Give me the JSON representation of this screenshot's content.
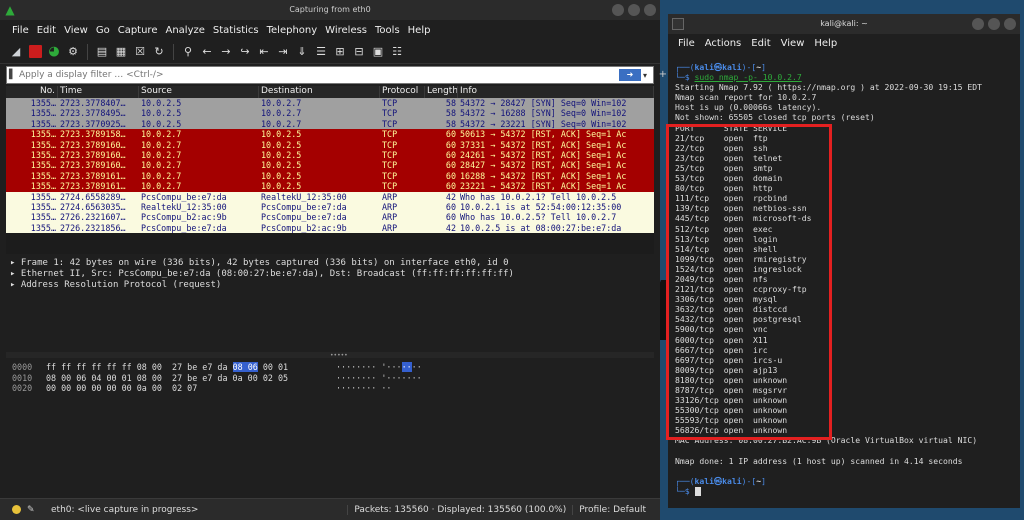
{
  "wireshark": {
    "title": "Capturing from eth0",
    "menu": [
      "File",
      "Edit",
      "View",
      "Go",
      "Capture",
      "Analyze",
      "Statistics",
      "Telephony",
      "Wireless",
      "Tools",
      "Help"
    ],
    "filter_placeholder": "Apply a display filter … <Ctrl-/>",
    "columns": [
      "No.",
      "Time",
      "Source",
      "Destination",
      "Protocol",
      "Length",
      "Info"
    ],
    "packets": [
      {
        "no": "1355…",
        "time": "2723.3778407…",
        "src": "10.0.2.5",
        "dst": "10.0.2.7",
        "proto": "TCP",
        "len": "58",
        "info": "54372 → 28427 [SYN] Seq=0 Win=102",
        "style": "gray"
      },
      {
        "no": "1355…",
        "time": "2723.3778495…",
        "src": "10.0.2.5",
        "dst": "10.0.2.7",
        "proto": "TCP",
        "len": "58",
        "info": "54372 → 16288 [SYN] Seq=0 Win=102",
        "style": "gray"
      },
      {
        "no": "1355…",
        "time": "2723.3770925…",
        "src": "10.0.2.5",
        "dst": "10.0.2.7",
        "proto": "TCP",
        "len": "58",
        "info": "54372 → 23221 [SYN] Seq=0 Win=102",
        "style": "gray"
      },
      {
        "no": "1355…",
        "time": "2723.3789158…",
        "src": "10.0.2.7",
        "dst": "10.0.2.5",
        "proto": "TCP",
        "len": "60",
        "info": "50613 → 54372 [RST, ACK] Seq=1 Ac",
        "style": "red"
      },
      {
        "no": "1355…",
        "time": "2723.3789160…",
        "src": "10.0.2.7",
        "dst": "10.0.2.5",
        "proto": "TCP",
        "len": "60",
        "info": "37331 → 54372 [RST, ACK] Seq=1 Ac",
        "style": "red"
      },
      {
        "no": "1355…",
        "time": "2723.3789160…",
        "src": "10.0.2.7",
        "dst": "10.0.2.5",
        "proto": "TCP",
        "len": "60",
        "info": "24261 → 54372 [RST, ACK] Seq=1 Ac",
        "style": "red"
      },
      {
        "no": "1355…",
        "time": "2723.3789160…",
        "src": "10.0.2.7",
        "dst": "10.0.2.5",
        "proto": "TCP",
        "len": "60",
        "info": "28427 → 54372 [RST, ACK] Seq=1 Ac",
        "style": "red"
      },
      {
        "no": "1355…",
        "time": "2723.3789161…",
        "src": "10.0.2.7",
        "dst": "10.0.2.5",
        "proto": "TCP",
        "len": "60",
        "info": "16288 → 54372 [RST, ACK] Seq=1 Ac",
        "style": "red"
      },
      {
        "no": "1355…",
        "time": "2723.3789161…",
        "src": "10.0.2.7",
        "dst": "10.0.2.5",
        "proto": "TCP",
        "len": "60",
        "info": "23221 → 54372 [RST, ACK] Seq=1 Ac",
        "style": "red"
      },
      {
        "no": "1355…",
        "time": "2724.6558289…",
        "src": "PcsCompu_be:e7:da",
        "dst": "RealtekU_12:35:00",
        "proto": "ARP",
        "len": "42",
        "info": "Who has 10.0.2.1? Tell 10.0.2.5",
        "style": "cream"
      },
      {
        "no": "1355…",
        "time": "2724.6563035…",
        "src": "RealtekU_12:35:00",
        "dst": "PcsCompu_be:e7:da",
        "proto": "ARP",
        "len": "60",
        "info": "10.0.2.1 is at 52:54:00:12:35:00",
        "style": "cream"
      },
      {
        "no": "1355…",
        "time": "2726.2321607…",
        "src": "PcsCompu_b2:ac:9b",
        "dst": "PcsCompu_be:e7:da",
        "proto": "ARP",
        "len": "60",
        "info": "Who has 10.0.2.5? Tell 10.0.2.7",
        "style": "cream"
      },
      {
        "no": "1355…",
        "time": "2726.2321856…",
        "src": "PcsCompu_be:e7:da",
        "dst": "PcsCompu_b2:ac:9b",
        "proto": "ARP",
        "len": "42",
        "info": "10.0.2.5 is at 08:00:27:be:e7:da",
        "style": "cream"
      }
    ],
    "details": [
      "Frame 1: 42 bytes on wire (336 bits), 42 bytes captured (336 bits) on interface eth0, id 0",
      "Ethernet II, Src: PcsCompu_be:e7:da (08:00:27:be:e7:da), Dst: Broadcast (ff:ff:ff:ff:ff:ff)",
      "Address Resolution Protocol (request)"
    ],
    "hex": [
      {
        "off": "0000",
        "pre": "ff ff ff ff ff ff 08 00  27 be e7 da ",
        "hl": "08 06",
        "post": " 00 01",
        "asc_pre": "········ '···",
        "asc_hl": "··",
        "asc_post": "··"
      },
      {
        "off": "0010",
        "pre": "08 00 06 04 00 01 08 00  27 be e7 da 0a 00 02 05",
        "hl": "",
        "post": "",
        "asc_pre": "········ '·······",
        "asc_hl": "",
        "asc_post": ""
      },
      {
        "off": "0020",
        "pre": "00 00 00 00 00 00 0a 00  02 07",
        "hl": "",
        "post": "",
        "asc_pre": "········ ··",
        "asc_hl": "",
        "asc_post": ""
      }
    ],
    "status": {
      "iface": "eth0: <live capture in progress>",
      "packets": "Packets: 135560 · Displayed: 135560 (100.0%)",
      "profile": "Profile: Default"
    }
  },
  "terminal": {
    "title": "kali@kali: ~",
    "menu": [
      "File",
      "Actions",
      "Edit",
      "View",
      "Help"
    ],
    "prompt_user": "kali㉿kali",
    "prompt_dir": "~",
    "command": "sudo nmap -p- 10.0.2.7",
    "output_head": [
      "Starting Nmap 7.92 ( https://nmap.org ) at 2022-09-30 19:15 EDT",
      "Nmap scan report for 10.0.2.7",
      "Host is up (0.00066s latency).",
      "Not shown: 65505 closed tcp ports (reset)"
    ],
    "ports_header": "PORT      STATE SERVICE",
    "ports": [
      "21/tcp    open  ftp",
      "22/tcp    open  ssh",
      "23/tcp    open  telnet",
      "25/tcp    open  smtp",
      "53/tcp    open  domain",
      "80/tcp    open  http",
      "111/tcp   open  rpcbind",
      "139/tcp   open  netbios-ssn",
      "445/tcp   open  microsoft-ds",
      "512/tcp   open  exec",
      "513/tcp   open  login",
      "514/tcp   open  shell",
      "1099/tcp  open  rmiregistry",
      "1524/tcp  open  ingreslock",
      "2049/tcp  open  nfs",
      "2121/tcp  open  ccproxy-ftp",
      "3306/tcp  open  mysql",
      "3632/tcp  open  distccd",
      "5432/tcp  open  postgresql",
      "5900/tcp  open  vnc",
      "6000/tcp  open  X11",
      "6667/tcp  open  irc",
      "6697/tcp  open  ircs-u",
      "8009/tcp  open  ajp13",
      "8180/tcp  open  unknown",
      "8787/tcp  open  msgsrvr",
      "33126/tcp open  unknown",
      "55300/tcp open  unknown",
      "55593/tcp open  unknown",
      "56826/tcp open  unknown"
    ],
    "mac_line": "MAC Address: 08:00:27:B2:AC:9B (Oracle VirtualBox virtual NIC)",
    "done_line": "Nmap done: 1 IP address (1 host up) scanned in 4.14 seconds"
  }
}
